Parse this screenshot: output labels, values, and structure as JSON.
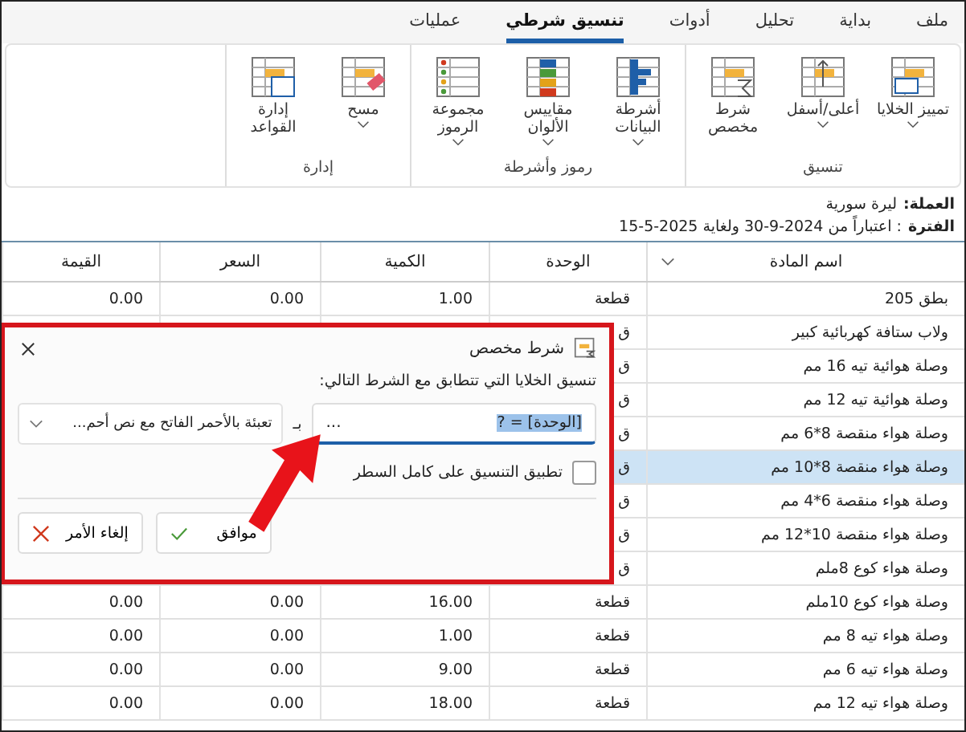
{
  "tabs": [
    {
      "label": "ملف",
      "selected": false
    },
    {
      "label": "بداية",
      "selected": false
    },
    {
      "label": "تحليل",
      "selected": false
    },
    {
      "label": "أدوات",
      "selected": false
    },
    {
      "label": "تنسيق شرطي",
      "selected": true
    },
    {
      "label": "عمليات",
      "selected": false
    }
  ],
  "ribbon_groups": [
    {
      "label": "تنسيق",
      "buttons": [
        {
          "label": "تمييز الخلايا",
          "dropdown": true
        },
        {
          "label": "أعلى/أسفل",
          "dropdown": true
        },
        {
          "label": "شرط مخصص",
          "dropdown": false
        }
      ]
    },
    {
      "label": "رموز وأشرطة",
      "buttons": [
        {
          "label": "أشرطة البيانات",
          "dropdown": true
        },
        {
          "label": "مقاييس الألوان",
          "dropdown": true
        },
        {
          "label": "مجموعة الرموز",
          "dropdown": true
        }
      ]
    },
    {
      "label": "إدارة",
      "buttons": [
        {
          "label": "مسح",
          "dropdown": true
        },
        {
          "label": "إدارة القواعد",
          "dropdown": false
        }
      ]
    }
  ],
  "info": [
    {
      "label": "العملة:",
      "value": "ليرة سورية"
    },
    {
      "label": "الفترة",
      "value": ": اعتباراً من 2024-9-30 ولغاية 2025-5-15"
    }
  ],
  "table": {
    "columns": [
      "اسم المادة",
      "الوحدة",
      "الكمية",
      "السعر",
      "القيمة"
    ],
    "rows": [
      {
        "cells": [
          "بطق 205",
          "قطعة",
          "1.00",
          "0.00",
          "0.00"
        ],
        "selected": false
      },
      {
        "cells": [
          "ولاب ستافة كهربائية كبير",
          "ق"
        ],
        "selected": false
      },
      {
        "cells": [
          "وصلة هوائية تيه 16 مم",
          "ق"
        ],
        "selected": false
      },
      {
        "cells": [
          "وصلة هوائية تيه 12 مم",
          "ق"
        ],
        "selected": false
      },
      {
        "cells": [
          "وصلة هواء منقصة 8*6 مم",
          "ق"
        ],
        "selected": false
      },
      {
        "cells": [
          "وصلة هواء منقصة 8*10 مم",
          "ق"
        ],
        "selected": true
      },
      {
        "cells": [
          "وصلة هواء منقصة 6*4 مم",
          "ق"
        ],
        "selected": false
      },
      {
        "cells": [
          "وصلة هواء منقصة 10*12 مم",
          "ق"
        ],
        "selected": false
      },
      {
        "cells": [
          "وصلة هواء كوع 8ملم",
          "ق"
        ],
        "selected": false
      },
      {
        "cells": [
          "وصلة هواء كوع 10ملم",
          "قطعة",
          "16.00",
          "0.00",
          "0.00"
        ],
        "selected": false
      },
      {
        "cells": [
          "وصلة هواء تيه 8 مم",
          "قطعة",
          "1.00",
          "0.00",
          "0.00"
        ],
        "selected": false
      },
      {
        "cells": [
          "وصلة هواء تيه 6 مم",
          "قطعة",
          "9.00",
          "0.00",
          "0.00"
        ],
        "selected": false
      },
      {
        "cells": [
          "وصلة هواء تيه 12 مم",
          "قطعة",
          "18.00",
          "0.00",
          "0.00"
        ],
        "selected": false
      }
    ]
  },
  "dialog": {
    "title": "شرط مخصص",
    "prompt": "تنسيق الخلايا التي تتطابق مع الشرط التالي:",
    "condition": {
      "value": "[الوحدة] = ?",
      "selected": true,
      "button": "..."
    },
    "connector": "بـ",
    "format": "تعبئة بالأحمر الفاتح مع نص أحم...",
    "apply_row": {
      "label": "تطبيق التنسيق على كامل السطر",
      "checked": false
    },
    "buttons": [
      {
        "label": "موافق",
        "kind": "ok"
      },
      {
        "label": "إلغاء الأمر",
        "kind": "cancel"
      }
    ]
  }
}
